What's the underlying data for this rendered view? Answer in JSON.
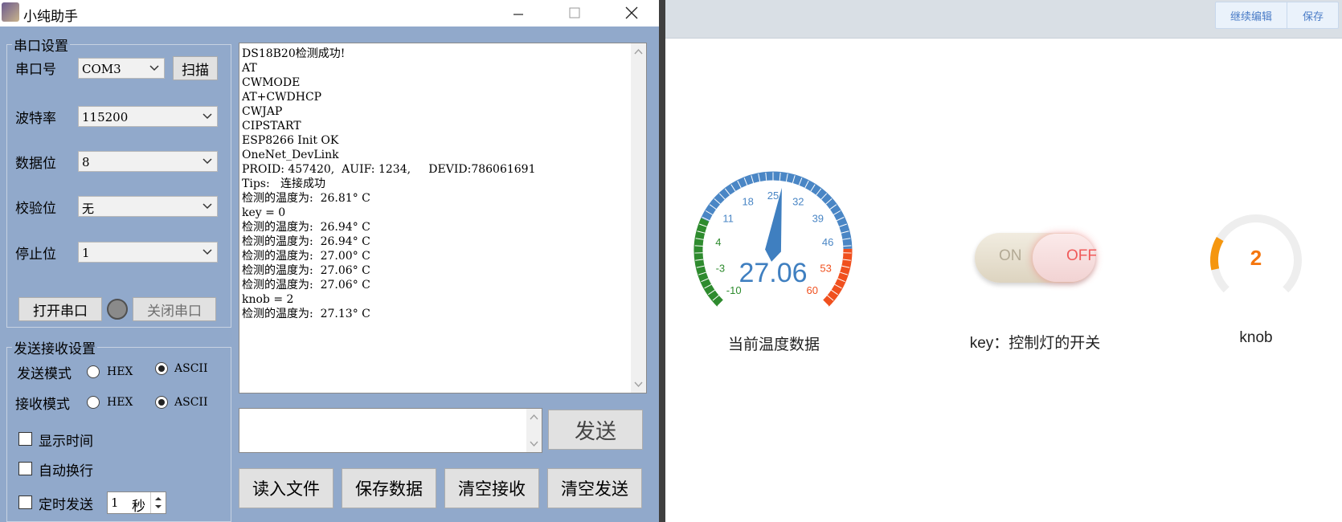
{
  "window": {
    "title": "小纯助手",
    "icon": "app-logo-icon"
  },
  "serial_settings": {
    "legend": "串口设置",
    "port": {
      "label": "串口号",
      "value": "COM3"
    },
    "scan_label": "扫描",
    "baud": {
      "label": "波特率",
      "value": "115200"
    },
    "databits": {
      "label": "数据位",
      "value": "8"
    },
    "parity": {
      "label": "校验位",
      "value": "无"
    },
    "stopbits": {
      "label": "停止位",
      "value": "1"
    },
    "open_label": "打开串口",
    "close_label": "关闭串口"
  },
  "send_recv": {
    "legend": "发送接收设置",
    "send_mode": {
      "label": "发送模式",
      "hex": "HEX",
      "ascii": "ASCII",
      "selected": "ASCII"
    },
    "recv_mode": {
      "label": "接收模式",
      "hex": "HEX",
      "ascii": "ASCII",
      "selected": "ASCII"
    },
    "show_time": "显示时间",
    "auto_wrap": "自动换行",
    "timed_send": "定时发送",
    "interval": {
      "value": "1",
      "unit": "秒"
    }
  },
  "receive_text": "DS18B20检测成功!\nAT\nCWMODE\nAT+CWDHCP\nCWJAP\nCIPSTART\nESP8266 Init OK\nOneNet_DevLink\nPROID: 457420,  AUIF: 1234,     DEVID:786061691\nTips:   连接成功\n检测的温度为:  26.81° C\nkey = 0\n检测的温度为:  26.94° C\n检测的温度为:  26.94° C\n检测的温度为:  27.00° C\n检测的温度为:  27.06° C\n检测的温度为:  27.06° C\nknob = 2\n检测的温度为:  27.13° C",
  "send_text": "",
  "buttons": {
    "send": "发送",
    "read_file": "读入文件",
    "save_data": "保存数据",
    "clear_recv": "清空接收",
    "clear_send": "清空发送"
  },
  "dashboard": {
    "toolbar": {
      "continue_edit": "继续编辑",
      "save": "保存"
    },
    "gauge": {
      "value": 27.06,
      "display": "27.06",
      "min": -10,
      "max": 60,
      "ticks": [
        "-10",
        "-3",
        "4",
        "11",
        "18",
        "25",
        "32",
        "39",
        "46",
        "53",
        "60"
      ],
      "caption": "当前温度数据",
      "colors": {
        "low": "#2e8b2e",
        "mid": "#4a86c5",
        "high": "#f0501e",
        "needle": "#3f7fc0"
      }
    },
    "switch": {
      "on_label": "ON",
      "off_label": "OFF",
      "state": "OFF",
      "caption": "key：控制灯的开关"
    },
    "knob": {
      "value": "2",
      "fraction": 0.2,
      "caption": "knob",
      "color": "#f5960e"
    }
  }
}
